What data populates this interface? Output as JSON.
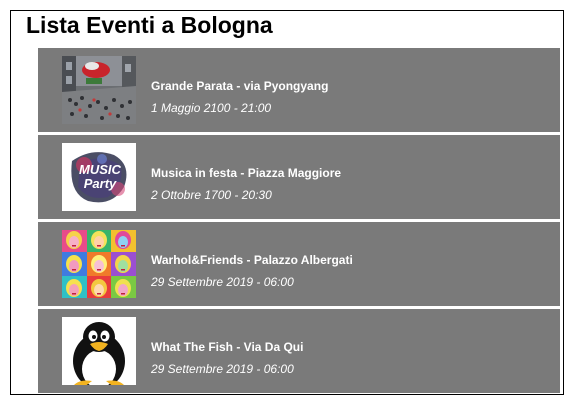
{
  "page": {
    "title": "Lista Eventi a Bologna"
  },
  "events": [
    {
      "name": "Grande Parata - via Pyongyang",
      "date": "1 Maggio 2100 - 21:00",
      "image": "parade-photo"
    },
    {
      "name": "Musica in festa - Piazza Maggiore",
      "date": "2 Ottobre 1700 - 20:30",
      "image": "music-party-poster",
      "image_text": "MUSIC Party"
    },
    {
      "name": "Warhol&Friends - Palazzo Albergati",
      "date": "29 Settembre 2019 - 06:00",
      "image": "pop-art-grid"
    },
    {
      "name": "What The Fish - Via Da Qui",
      "date": "29 Settembre 2019 - 06:00",
      "image": "penguin-mascot"
    }
  ],
  "colors": {
    "row_bg": "#7a7a7a",
    "text": "#ffffff",
    "title": "#000000"
  }
}
